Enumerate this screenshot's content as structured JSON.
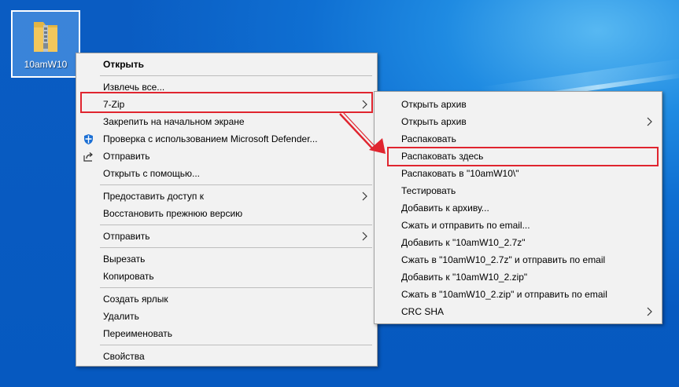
{
  "desktop_icon": {
    "label": "10amW10",
    "icon": "zip-folder-icon"
  },
  "main_menu": {
    "open": "Открыть",
    "extract_all": "Извлечь все...",
    "seven_zip": "7-Zip",
    "pin_start": "Закрепить на начальном экране",
    "defender_scan": "Проверка с использованием Microsoft Defender...",
    "share": "Отправить",
    "open_with": "Открыть с помощью...",
    "give_access": "Предоставить доступ к",
    "restore_previous": "Восстановить прежнюю версию",
    "send_to": "Отправить",
    "cut": "Вырезать",
    "copy": "Копировать",
    "create_shortcut": "Создать ярлык",
    "delete": "Удалить",
    "rename": "Переименовать",
    "properties": "Свойства"
  },
  "sub_menu": {
    "open_archive": "Открыть архив",
    "open_archive_submenu": "Открыть архив",
    "extract_files": "Распаковать",
    "extract_here": "Распаковать здесь",
    "extract_to": "Распаковать в \"10amW10\\\"",
    "test": "Тестировать",
    "add_to_archive": "Добавить к архиву...",
    "compress_email": "Сжать и отправить по email...",
    "add_7z": "Добавить к \"10amW10_2.7z\"",
    "compress_7z_email": "Сжать в \"10amW10_2.7z\" и отправить по email",
    "add_zip": "Добавить к \"10amW10_2.zip\"",
    "compress_zip_email": "Сжать в \"10amW10_2.zip\" и отправить по email",
    "crc_sha": "CRC SHA"
  },
  "colors": {
    "annotation_red": "#e0252f",
    "menu_bg": "#f2f2f2",
    "desktop_blue": "#0659c0"
  }
}
